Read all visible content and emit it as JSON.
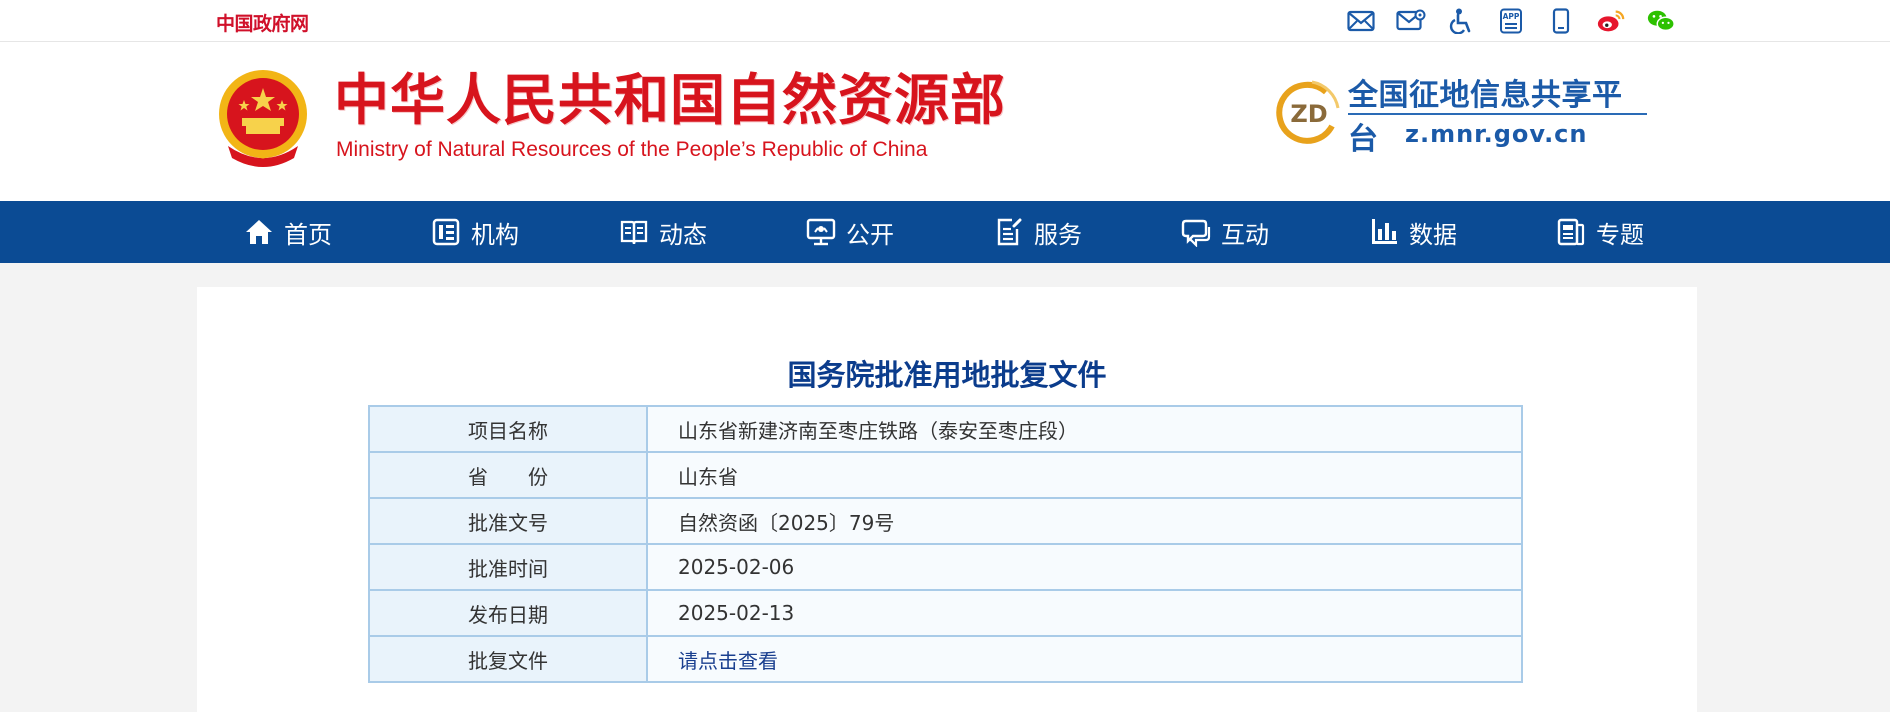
{
  "topbar": {
    "gov_link": "中国政府网",
    "icons": [
      "mail-icon",
      "mail-settings-icon",
      "accessibility-icon",
      "app-icon",
      "mobile-icon",
      "weibo-icon",
      "wechat-icon"
    ]
  },
  "header": {
    "site_name_cn": "中华人民共和国自然资源部",
    "site_name_en": "Ministry of Natural Resources of the People’s Republic of China",
    "platform_badge": "ZD",
    "platform_name": "全国征地信息共享平台",
    "platform_url": "z.mnr.gov.cn"
  },
  "nav": {
    "items": [
      {
        "label": "首页",
        "icon": "home-icon"
      },
      {
        "label": "机构",
        "icon": "organization-icon"
      },
      {
        "label": "动态",
        "icon": "news-icon"
      },
      {
        "label": "公开",
        "icon": "disclosure-icon"
      },
      {
        "label": "服务",
        "icon": "service-icon"
      },
      {
        "label": "互动",
        "icon": "interaction-icon"
      },
      {
        "label": "数据",
        "icon": "data-icon"
      },
      {
        "label": "专题",
        "icon": "topic-icon"
      }
    ]
  },
  "document": {
    "title": "国务院批准用地批复文件",
    "rows": [
      {
        "key": "项目名称",
        "value": "山东省新建济南至枣庄铁路（泰安至枣庄段）"
      },
      {
        "key": "省　　份",
        "value": "山东省"
      },
      {
        "key": "批准文号",
        "value": "自然资函〔2025〕79号"
      },
      {
        "key": "批准时间",
        "value": "2025-02-06"
      },
      {
        "key": "发布日期",
        "value": "2025-02-13"
      },
      {
        "key": "批复文件",
        "value": "请点击查看"
      }
    ]
  },
  "colors": {
    "brand_red": "#d7141d",
    "nav_blue": "#0b4b94",
    "title_blue": "#0b3c8c",
    "table_border": "#a9cbe8"
  }
}
